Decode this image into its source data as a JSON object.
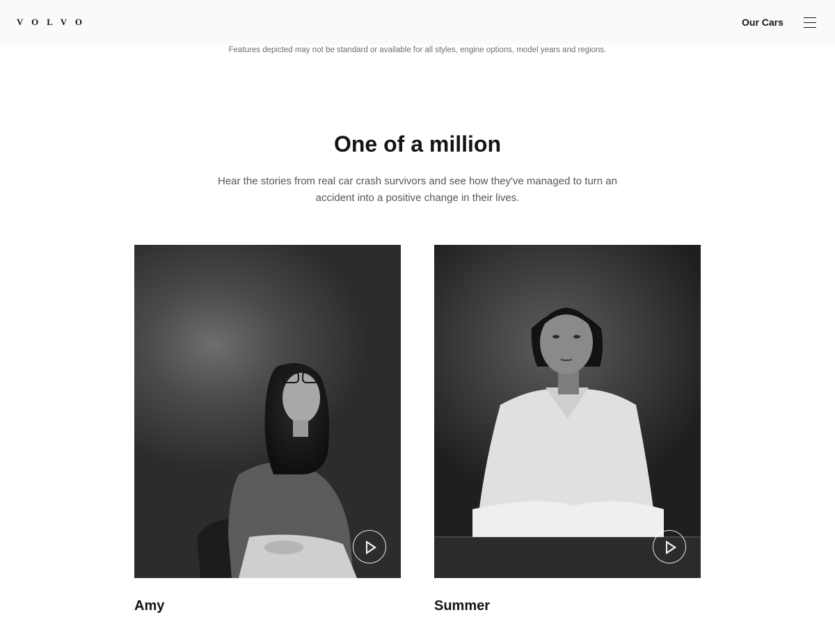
{
  "header": {
    "logo_text": "VOLVO",
    "nav_link": "Our Cars"
  },
  "disclaimer": "Features depicted may not be standard or available for all styles, engine options, model years and regions.",
  "section": {
    "title": "One of a million",
    "description": "Hear the stories from real car crash survivors and see how they've managed to turn an accident into a positive change in their lives."
  },
  "stories": [
    {
      "name": "Amy",
      "image": "Black and white portrait of a seated woman with glasses",
      "action_icon": "play-icon"
    },
    {
      "name": "Summer",
      "image": "Black and white portrait of a woman with arms crossed at a table",
      "action_icon": "play-icon"
    }
  ]
}
